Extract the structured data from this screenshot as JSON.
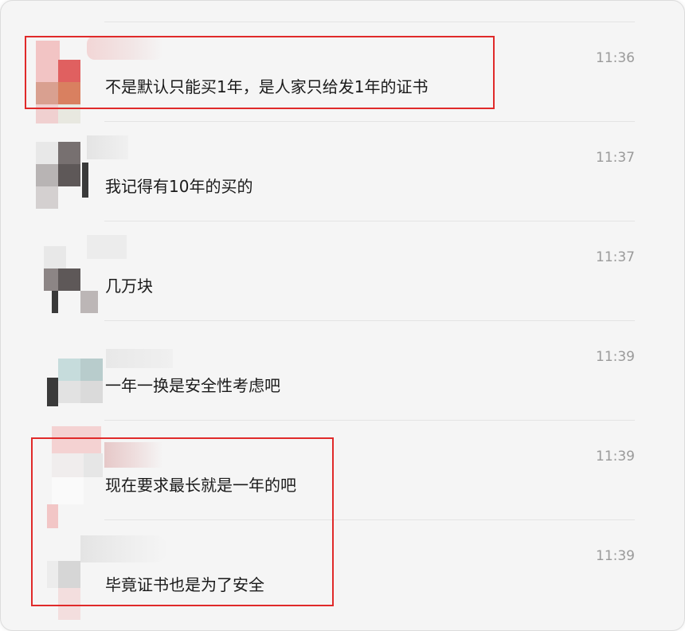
{
  "messages": [
    {
      "time": "11:36",
      "text": "不是默认只能买1年，是人家只给发1年的证书"
    },
    {
      "time": "11:37",
      "text": "我记得有10年的买的"
    },
    {
      "time": "11:37",
      "text": "几万块"
    },
    {
      "time": "11:39",
      "text": "一年一换是安全性考虑吧"
    },
    {
      "time": "11:39",
      "text": "现在要求最长就是一年的吧"
    },
    {
      "time": "11:39",
      "text": "毕竟证书也是为了安全"
    }
  ],
  "colors": {
    "highlight": "#e02a2a",
    "background": "#f5f5f5",
    "time": "#9a9a9a",
    "text": "#1a1a1a"
  }
}
